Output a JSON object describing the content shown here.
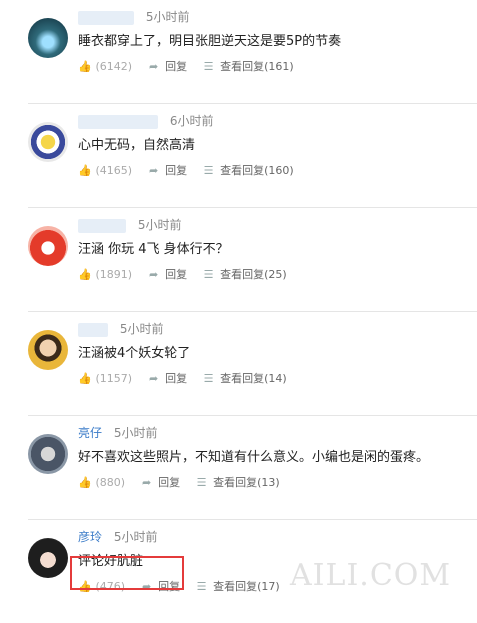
{
  "comments": [
    {
      "user": "",
      "time": "5小时前",
      "text": "睡衣都穿上了，明目张胆逆天这是要5P的节奏",
      "likes": "(6142)",
      "reply_label": "回复",
      "view_label": "查看回复(161)"
    },
    {
      "user": "",
      "time": "6小时前",
      "text": "心中无码，自然高清",
      "likes": "(4165)",
      "reply_label": "回复",
      "view_label": "查看回复(160)"
    },
    {
      "user": "",
      "time": "5小时前",
      "text": "汪涵 你玩 4飞 身体行不？",
      "likes": "(1891)",
      "reply_label": "回复",
      "view_label": "查看回复(25)"
    },
    {
      "user": "",
      "time": "5小时前",
      "text": "汪涵被4个妖女轮了",
      "likes": "(1157)",
      "reply_label": "回复",
      "view_label": "查看回复(14)"
    },
    {
      "user": "亮仔",
      "time": "5小时前",
      "text": "好不喜欢这些照片，不知道有什么意义。小编也是闲的蛋疼。",
      "likes": "(880)",
      "reply_label": "回复",
      "view_label": "查看回复(13)"
    },
    {
      "user": "彦玲",
      "time": "5小时前",
      "text": "评论好肮脏",
      "likes": "(476)",
      "reply_label": "回复",
      "view_label": "查看回复(17)"
    }
  ],
  "watermark": "AILI.COM",
  "icons": {
    "like": "thumbs-up-icon",
    "reply": "arrow-reply-icon",
    "view": "list-icon"
  },
  "colors": {
    "username": "#3a7bc8",
    "highlight": "#e43b3b",
    "divider": "#e5e5e5"
  }
}
